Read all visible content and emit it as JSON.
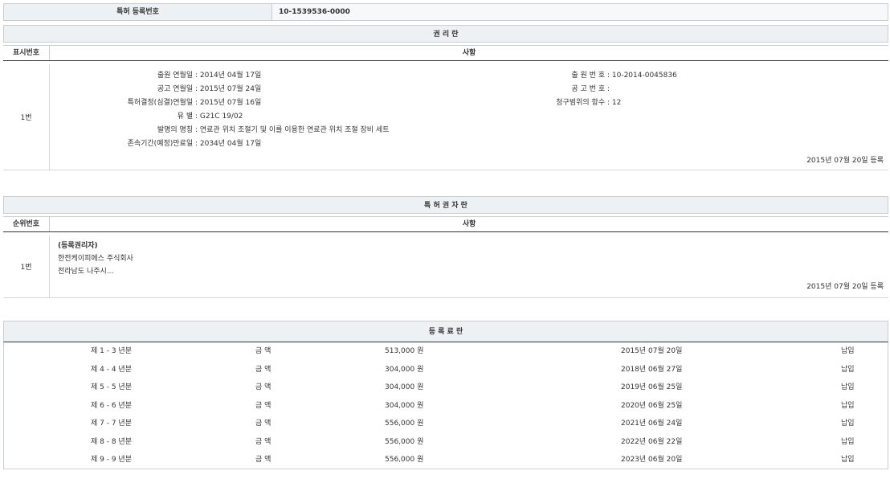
{
  "top": {
    "label": "특허 등록번호",
    "value": "10-1539536-0000"
  },
  "rights": {
    "title": "권 리 란",
    "col1": "표시번호",
    "col2": "사항",
    "row_no": "1번",
    "left": [
      {
        "k": "출원 연월일 :",
        "v": "2014년 04월 17일"
      },
      {
        "k": "공고 연월일 :",
        "v": "2015년 07월 24일"
      },
      {
        "k": "특허결정(심결)연월일 :",
        "v": "2015년 07월 16일"
      },
      {
        "k": "유 별 :",
        "v": "G21C 19/02"
      },
      {
        "k": "발명의 명칭 :",
        "v": "연료관 위치 조절기 및 이를 이용한 연료관 위치 조절 장비 세트"
      },
      {
        "k": "존속기간(예정)만료일 :",
        "v": "2034년 04월 17일"
      }
    ],
    "right": [
      {
        "k": "출 원 번 호 :",
        "v": "10-2014-0045836"
      },
      {
        "k": "공 고 번 호 :",
        "v": ""
      },
      {
        "k": "청구범위의 항수 :",
        "v": "12"
      }
    ],
    "reg": "2015년 07월 20일 등록"
  },
  "holder": {
    "title": "특 허 권 자 란",
    "col1": "순위번호",
    "col2": "사항",
    "row_no": "1번",
    "line1": "(등록권리자)",
    "line2": "한전케이피에스 주식회사",
    "line3": "전라남도 나주시...",
    "reg": "2015년 07월 20일 등록"
  },
  "fees": {
    "title": "등 록 료 란",
    "rows": [
      {
        "term": "제 1 - 3 년분",
        "label": "금 액",
        "amount": "513,000 원",
        "date": "2015년 07월 20일",
        "status": "납입"
      },
      {
        "term": "제 4 - 4 년분",
        "label": "금 액",
        "amount": "304,000 원",
        "date": "2018년 06월 27일",
        "status": "납입"
      },
      {
        "term": "제 5 - 5 년분",
        "label": "금 액",
        "amount": "304,000 원",
        "date": "2019년 06월 25일",
        "status": "납입"
      },
      {
        "term": "제 6 - 6 년분",
        "label": "금 액",
        "amount": "304,000 원",
        "date": "2020년 06월 25일",
        "status": "납입"
      },
      {
        "term": "제 7 - 7 년분",
        "label": "금 액",
        "amount": "556,000 원",
        "date": "2021년 06월 24일",
        "status": "납입"
      },
      {
        "term": "제 8 - 8 년분",
        "label": "금 액",
        "amount": "556,000 원",
        "date": "2022년 06월 22일",
        "status": "납입"
      },
      {
        "term": "제 9 - 9 년분",
        "label": "금 액",
        "amount": "556,000 원",
        "date": "2023년 06월 20일",
        "status": "납입"
      }
    ]
  }
}
